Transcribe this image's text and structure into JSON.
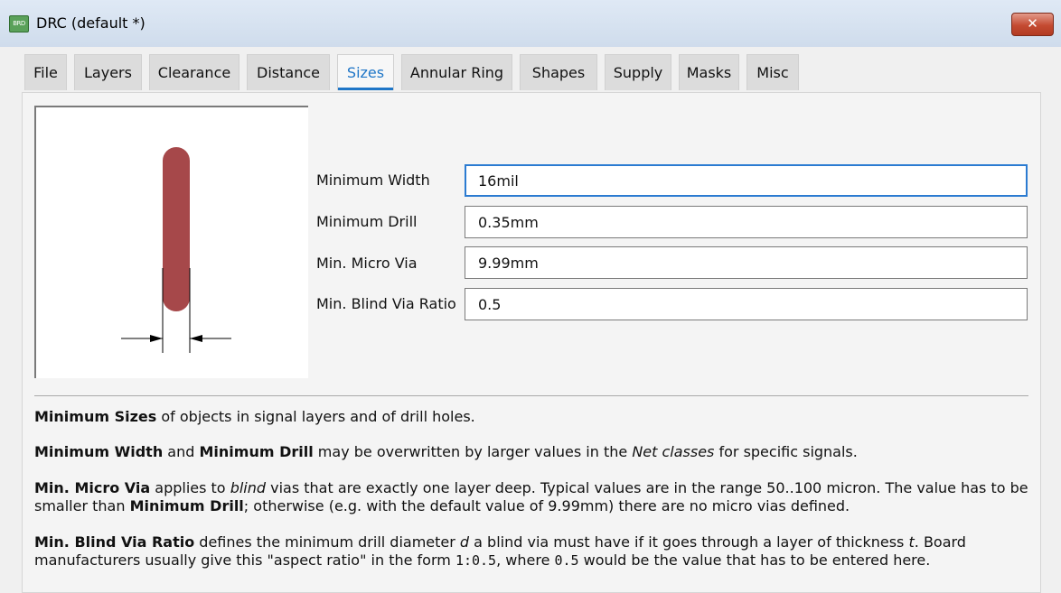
{
  "window": {
    "title": "DRC (default *)",
    "app_icon_text": "BRD",
    "close_icon": "close-icon",
    "close_glyph": "✕"
  },
  "tabs": [
    {
      "label": "File",
      "active": false
    },
    {
      "label": "Layers",
      "active": false
    },
    {
      "label": "Clearance",
      "active": false
    },
    {
      "label": "Distance",
      "active": false
    },
    {
      "label": "Sizes",
      "active": true
    },
    {
      "label": "Annular Ring",
      "active": false
    },
    {
      "label": "Shapes",
      "active": false
    },
    {
      "label": "Supply",
      "active": false
    },
    {
      "label": "Masks",
      "active": false
    },
    {
      "label": "Misc",
      "active": false
    }
  ],
  "fields": [
    {
      "label": "Minimum Width",
      "value": "16mil",
      "focused": true
    },
    {
      "label": "Minimum Drill",
      "value": "0.35mm",
      "focused": false
    },
    {
      "label": "Min. Micro Via",
      "value": "9.99mm",
      "focused": false
    },
    {
      "label": "Min. Blind Via Ratio",
      "value": "0.5",
      "focused": false
    }
  ],
  "description": {
    "p1": [
      {
        "t": "Minimum Sizes",
        "s": "b"
      },
      {
        "t": " of objects in signal layers and of drill holes.",
        "s": ""
      }
    ],
    "p2": [
      {
        "t": "Minimum Width",
        "s": "b"
      },
      {
        "t": " and ",
        "s": ""
      },
      {
        "t": "Minimum Drill",
        "s": "b"
      },
      {
        "t": " may be overwritten by larger values in the ",
        "s": ""
      },
      {
        "t": "Net classes",
        "s": "i"
      },
      {
        "t": " for specific signals.",
        "s": ""
      }
    ],
    "p3": [
      {
        "t": "Min. Micro Via",
        "s": "b"
      },
      {
        "t": " applies to ",
        "s": ""
      },
      {
        "t": "blind",
        "s": "i"
      },
      {
        "t": " vias that are exactly one layer deep. Typical values are in the range 50..100 micron. The value has to be smaller than ",
        "s": ""
      },
      {
        "t": "Minimum Drill",
        "s": "b"
      },
      {
        "t": "; otherwise (e.g. with the default value of 9.99mm) there are no micro vias defined.",
        "s": ""
      }
    ],
    "p4": [
      {
        "t": "Min. Blind Via Ratio",
        "s": "b"
      },
      {
        "t": " defines the minimum drill diameter ",
        "s": ""
      },
      {
        "t": "d",
        "s": "i"
      },
      {
        "t": " a blind via must have if it goes through a layer of thickness ",
        "s": ""
      },
      {
        "t": "t",
        "s": "i"
      },
      {
        "t": ". Board manufacturers usually give this \"aspect ratio\" in the form ",
        "s": ""
      },
      {
        "t": "1:0.5",
        "s": "m"
      },
      {
        "t": ", where ",
        "s": ""
      },
      {
        "t": "0.5",
        "s": "m"
      },
      {
        "t": " would be the value that has to be entered here.",
        "s": ""
      }
    ]
  },
  "preview": {
    "trace_color": "#a6484a",
    "icon": "track-width-diagram-icon"
  }
}
